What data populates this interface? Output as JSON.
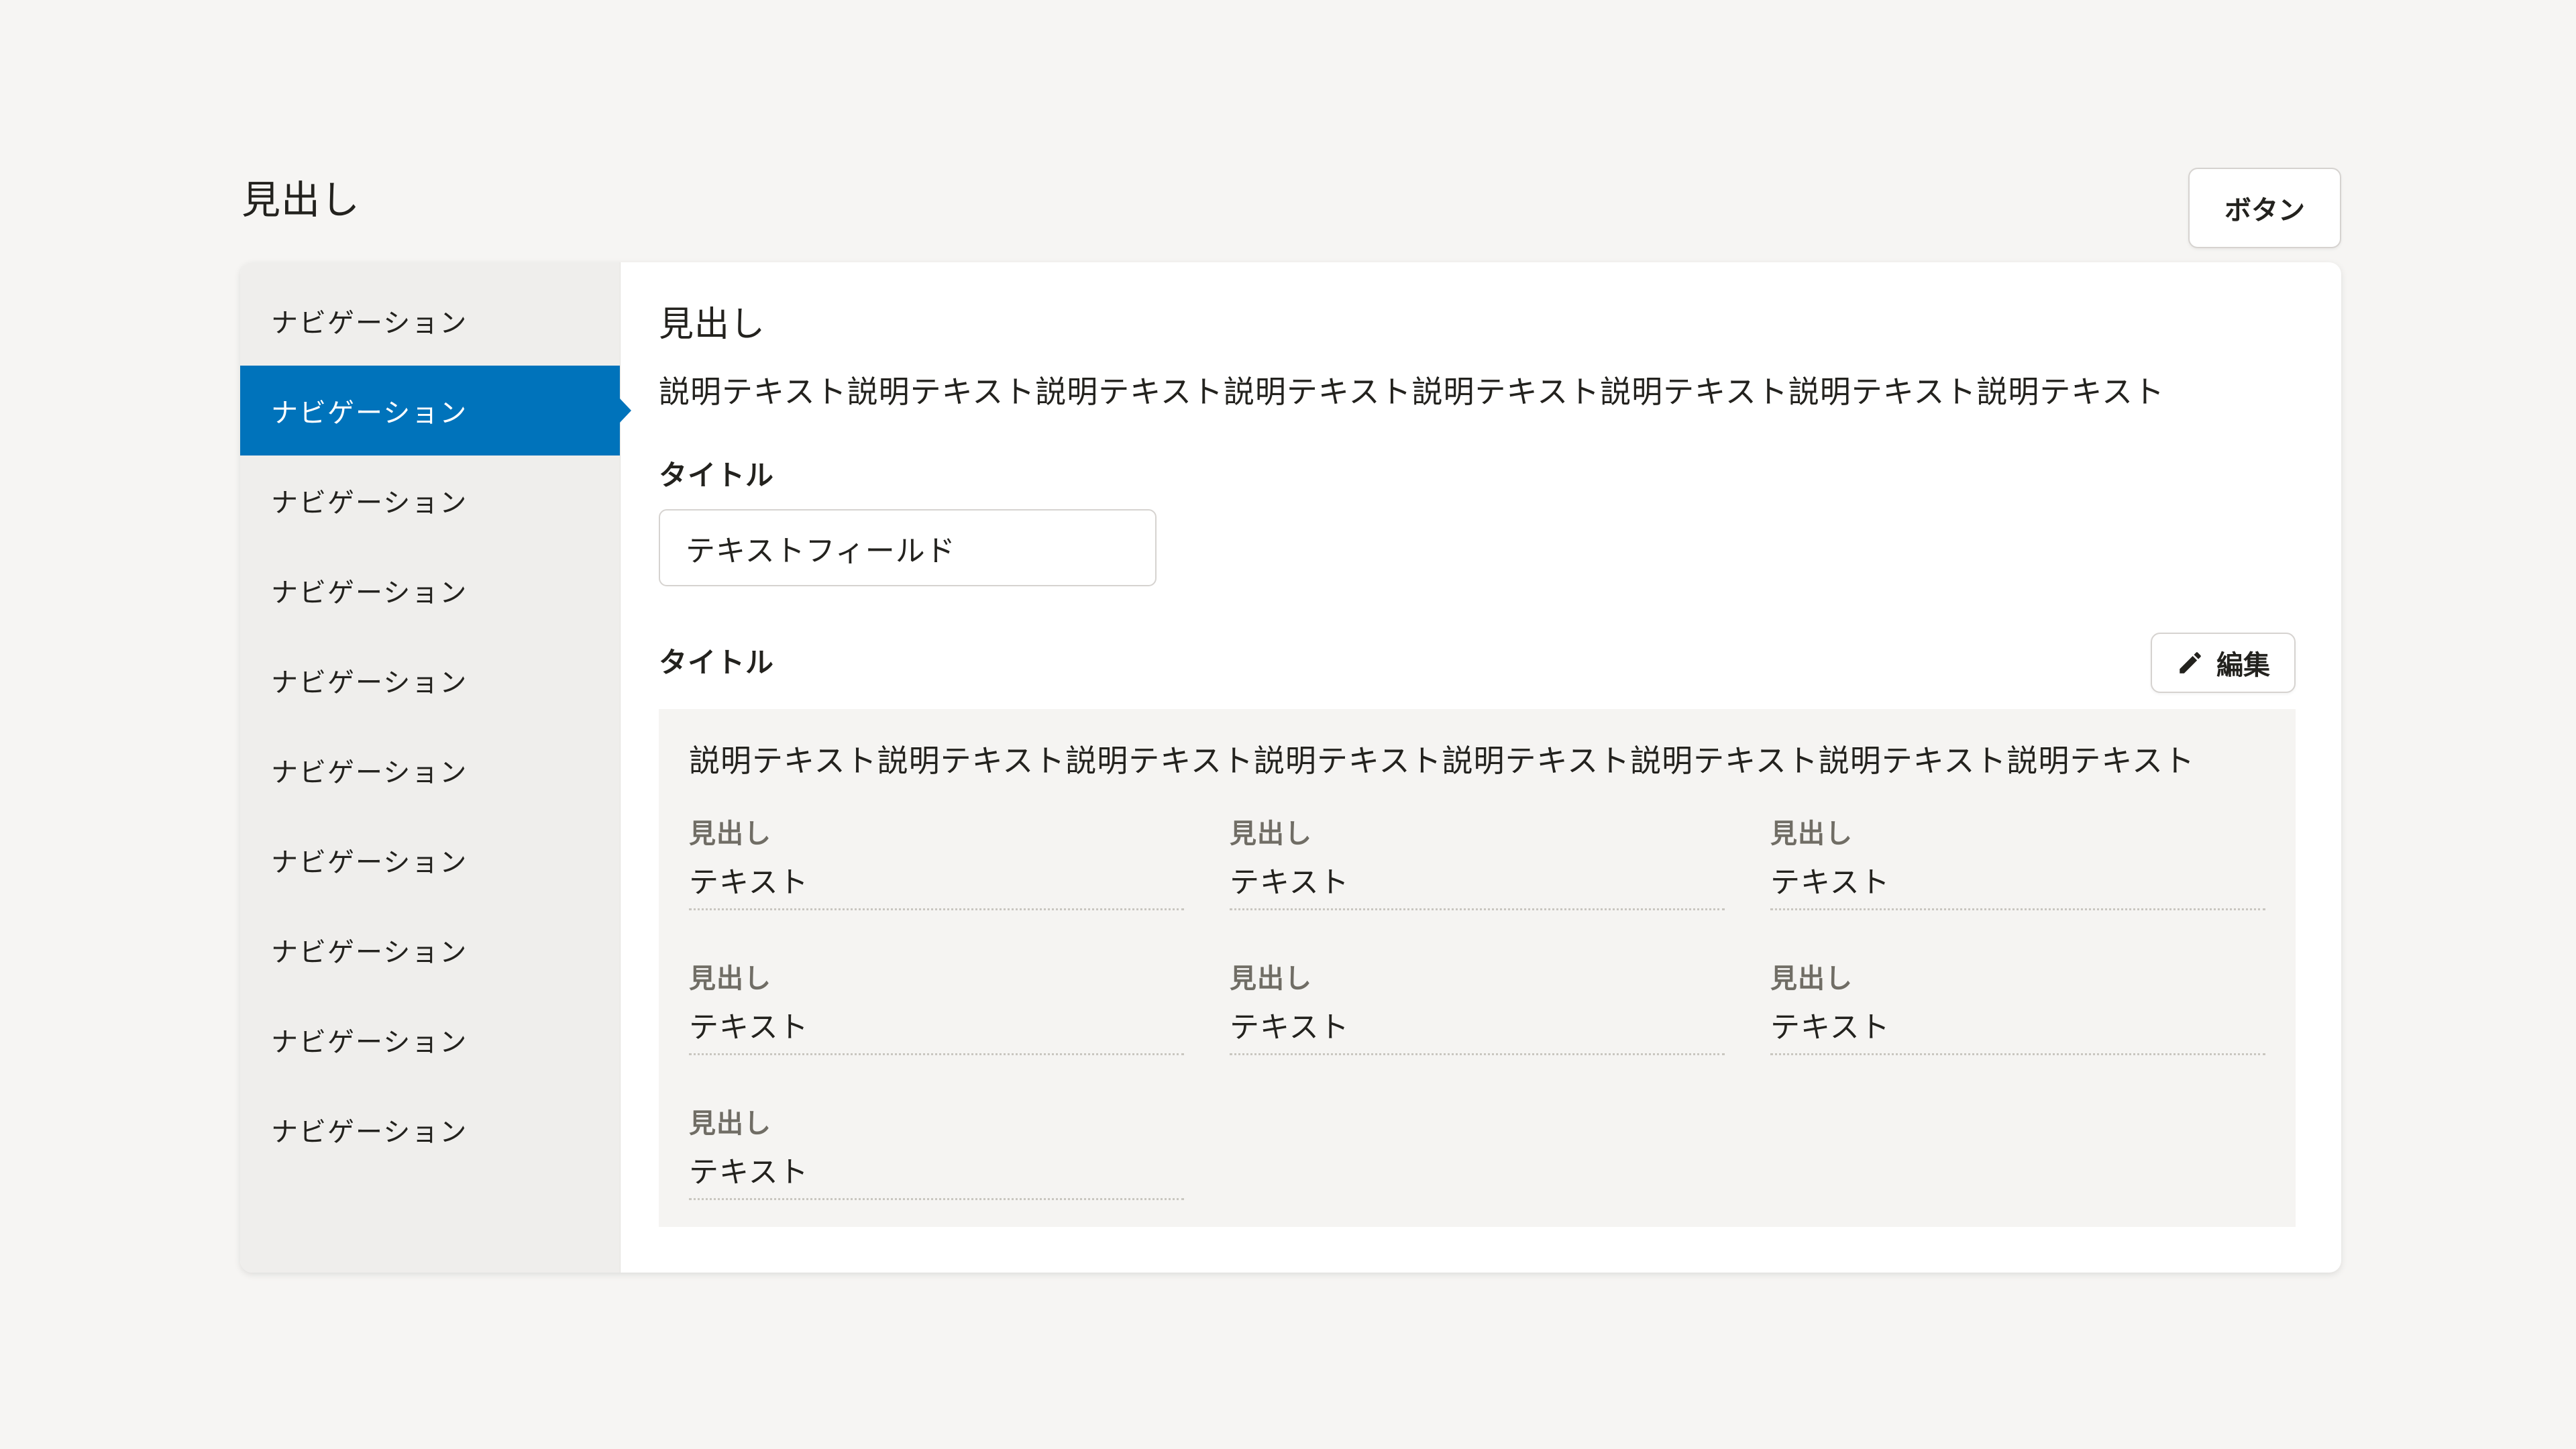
{
  "page": {
    "title": "見出し",
    "action_button_label": "ボタン"
  },
  "colors": {
    "accent_blue": "#0073bb",
    "text_black": "#23221e",
    "text_grey": "#706d65",
    "border": "#d6d3d0",
    "sidebar_bg": "#efeeec",
    "panel_bg": "#f5f4f2",
    "page_bg": "#f6f5f3"
  },
  "sidebar": {
    "items": [
      {
        "label": "ナビゲーション",
        "selected": false
      },
      {
        "label": "ナビゲーション",
        "selected": true
      },
      {
        "label": "ナビゲーション",
        "selected": false
      },
      {
        "label": "ナビゲーション",
        "selected": false
      },
      {
        "label": "ナビゲーション",
        "selected": false
      },
      {
        "label": "ナビゲーション",
        "selected": false
      },
      {
        "label": "ナビゲーション",
        "selected": false
      },
      {
        "label": "ナビゲーション",
        "selected": false
      },
      {
        "label": "ナビゲーション",
        "selected": false
      },
      {
        "label": "ナビゲーション",
        "selected": false
      }
    ]
  },
  "content": {
    "heading": "見出し",
    "description": "説明テキスト説明テキスト説明テキスト説明テキスト説明テキスト説明テキスト説明テキスト説明テキスト",
    "field_label": "タイトル",
    "field_value": "テキストフィールド",
    "section_title": "タイトル",
    "edit_button": {
      "label": "編集",
      "icon": "pencil-icon"
    },
    "panel": {
      "description": "説明テキスト説明テキスト説明テキスト説明テキスト説明テキスト説明テキスト説明テキスト説明テキスト",
      "fields": [
        {
          "label": "見出し",
          "value": "テキスト"
        },
        {
          "label": "見出し",
          "value": "テキスト"
        },
        {
          "label": "見出し",
          "value": "テキスト"
        },
        {
          "label": "見出し",
          "value": "テキスト"
        },
        {
          "label": "見出し",
          "value": "テキスト"
        },
        {
          "label": "見出し",
          "value": "テキスト"
        },
        {
          "label": "見出し",
          "value": "テキスト"
        }
      ]
    }
  }
}
